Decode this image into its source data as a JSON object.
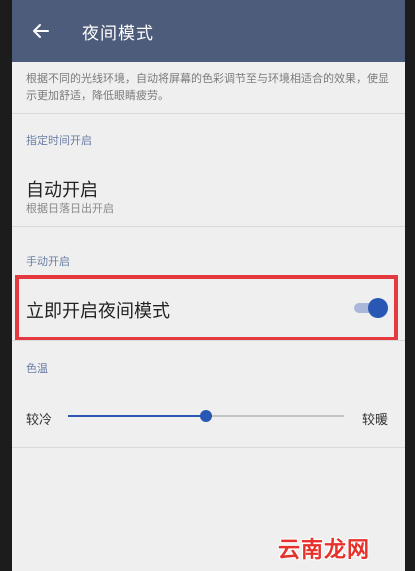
{
  "appbar": {
    "title": "夜间模式",
    "back_icon": "arrow-left-icon"
  },
  "description": "根据不同的光线环境，自动将屏幕的色彩调节至与环境相适合的效果，使显示更加舒适，降低眼睛疲劳。",
  "scheduled": {
    "header": "指定时间开启",
    "auto": {
      "title": "自动开启",
      "subtitle": "根据日落日出开启"
    }
  },
  "manual": {
    "header": "手动开启",
    "now": {
      "title": "立即开启夜间模式",
      "enabled": true
    }
  },
  "color_temp": {
    "header": "色温",
    "min_label": "较冷",
    "max_label": "较暖",
    "value": 0.5
  },
  "watermark": "云南龙网",
  "colors": {
    "appbar": "#4d5c7a",
    "accent": "#2a57b4",
    "highlight": "#e43a3f"
  }
}
